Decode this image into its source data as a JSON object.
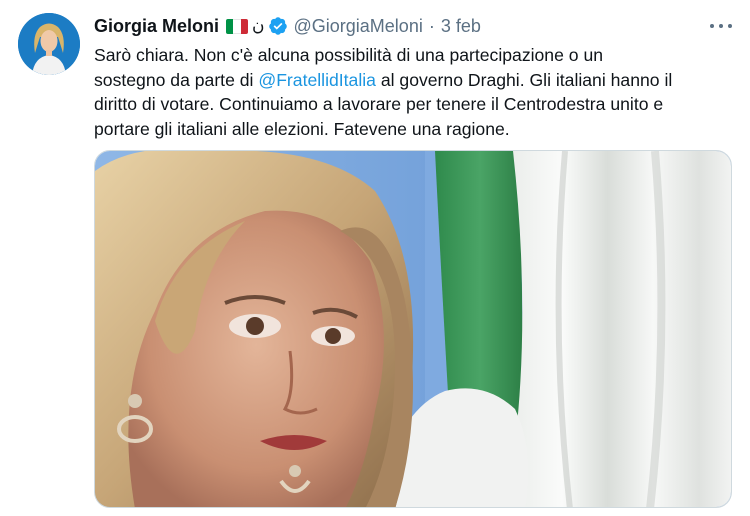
{
  "author": {
    "name": "Giorgia Meloni",
    "handle": "@GiorgiaMeloni",
    "extra_glyph": "ن",
    "flag": [
      "#009246",
      "#ffffff",
      "#ce2b37"
    ],
    "verified": true
  },
  "meta": {
    "separator": "·",
    "date": "3 feb"
  },
  "text": {
    "line1": "Sarò chiara. Non c'è alcuna possibilità di una partecipazione o un",
    "line2_before": "sostegno da parte di ",
    "mention": "@FratellidItalia",
    "line2_after": " al governo Draghi. Gli italiani hanno il",
    "line3": "diritto di votare. Continuiamo a lavorare per tenere il Centrodestra unito e",
    "line4": "portare gli italiani alle elezioni. Fatevene una ragione."
  },
  "colors": {
    "link": "#1b95e0",
    "secondary_text": "#5b7083",
    "verified_badge": "#1da1f2"
  },
  "icons": {
    "verified": "verified-badge-icon",
    "more": "more-options-icon"
  }
}
